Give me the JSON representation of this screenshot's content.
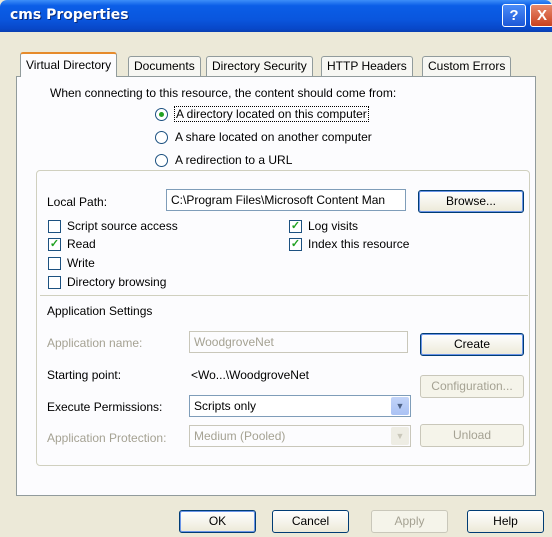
{
  "window": {
    "title": "cms Properties"
  },
  "tabs": [
    "Virtual Directory",
    "Documents",
    "Directory Security",
    "HTTP Headers",
    "Custom Errors"
  ],
  "source": {
    "prompt": "When connecting to this resource, the content should come from:",
    "options": [
      "A directory located on this computer",
      "A share located on another computer",
      "A redirection to a URL"
    ],
    "selected_index": 0
  },
  "local_path": {
    "label": "Local Path:",
    "value": "C:\\Program Files\\Microsoft Content Man",
    "browse": "Browse..."
  },
  "permissions": {
    "script_source_access": {
      "label": "Script source access",
      "checked": false
    },
    "read": {
      "label": "Read",
      "checked": true
    },
    "write": {
      "label": "Write",
      "checked": false
    },
    "directory_browsing": {
      "label": "Directory browsing",
      "checked": false
    },
    "log_visits": {
      "label": "Log visits",
      "checked": true
    },
    "index_resource": {
      "label": "Index this resource",
      "checked": true
    }
  },
  "app_settings": {
    "header": "Application Settings",
    "app_name_label": "Application name:",
    "app_name_value": "WoodgroveNet",
    "create": "Create",
    "starting_point_label": "Starting point:",
    "starting_point_value": "<Wo...\\WoodgroveNet",
    "configuration": "Configuration...",
    "execute_label": "Execute Permissions:",
    "execute_value": "Scripts only",
    "protection_label": "Application Protection:",
    "protection_value": "Medium (Pooled)",
    "unload": "Unload"
  },
  "buttons": {
    "ok": "OK",
    "cancel": "Cancel",
    "apply": "Apply",
    "help": "Help"
  },
  "glyphs": {
    "help": "?",
    "close": "X",
    "check": "✓",
    "dropdown": "▼"
  }
}
